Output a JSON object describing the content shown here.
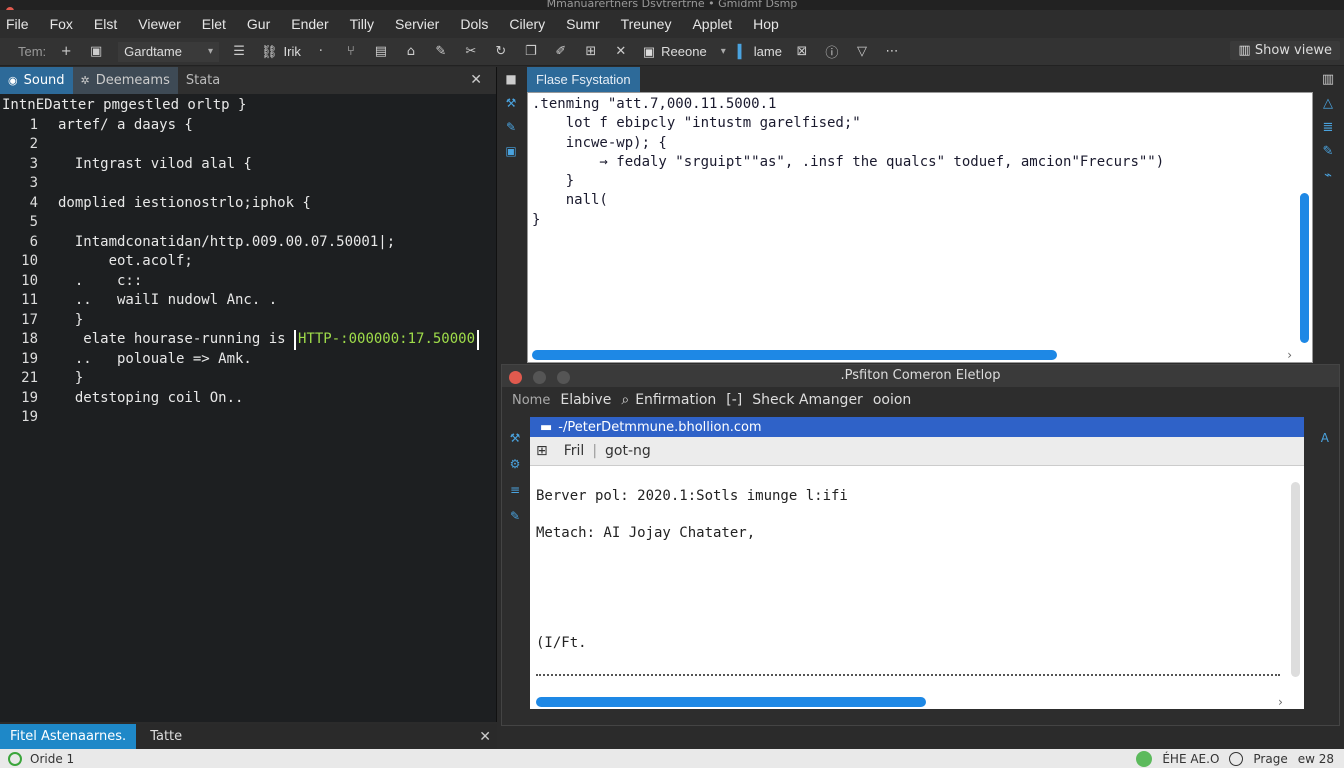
{
  "window": {
    "title": "Mmanuarertners Dsvtrertrne • Gmidmf Dsmp"
  },
  "menubar": [
    "File",
    "Fox",
    "Elst",
    "Viewer",
    "Elet",
    "Gur",
    "Ender",
    "Tilly",
    "Servier",
    "Dols",
    "Cilery",
    "Sumr",
    "Treuney",
    "Applet",
    "Hop"
  ],
  "toolbar": {
    "term_label": "Tem:",
    "select_value": "Gardtame",
    "link_label": "Irik",
    "rename_label": "Reeone",
    "lame_label": "lame",
    "show_view": "Show viewe"
  },
  "left_panel": {
    "tabs": [
      "Sound",
      "Deemeams",
      "Stata"
    ],
    "header": "IntnEDatter pmgestled orltp }",
    "lines": [
      {
        "num": "1",
        "text": "artef/ a daays {"
      },
      {
        "num": "2",
        "text": ""
      },
      {
        "num": "3",
        "text": "  Intgrast vilod alal {"
      },
      {
        "num": "3",
        "text": ""
      },
      {
        "num": "4",
        "text": "domplied iestionostrlo;iphok {"
      },
      {
        "num": "5",
        "text": ""
      },
      {
        "num": "6",
        "text": "  Intamdconatidan/http.009.00.07.50001|;"
      },
      {
        "num": "10",
        "text": "      eot.acolf;"
      },
      {
        "num": "10",
        "text": "  .    c::"
      },
      {
        "num": "11",
        "text": "  ..   wailI nudowl Anc. ."
      },
      {
        "num": "17",
        "text": "  }"
      },
      {
        "num": "18",
        "text": "   elate hourase-running is ",
        "highlight": "HTTP-:000000:17.50000"
      },
      {
        "num": "19",
        "text": "  ..   polouale => Amk."
      },
      {
        "num": "21",
        "text": "  }"
      },
      {
        "num": "19",
        "text": "  detstoping coil On.."
      },
      {
        "num": "19",
        "text": ""
      }
    ],
    "bottom_tabs": [
      "Fitel Astenaarnes.",
      "Tatte"
    ]
  },
  "right_top": {
    "tab": "Flase Fsystation",
    "lines": [
      ".tenming \"att.7,000.11.5000.1",
      "    lot f ebipcly \"intustm garelfised;\"",
      "    incwe-wp); {",
      "        → fedaly \"srguipt\"\"as\", .insf the qualcs\" toduef, amcion\"Frecurs\"\")",
      "    }",
      "    nall(",
      "}"
    ]
  },
  "bottom_window": {
    "title": ".Psfiton Comeron Eletlop",
    "menu": [
      "Nome",
      "Elabive",
      "Enfirmation",
      "[-]",
      "Sheck Amanger",
      "ooion"
    ],
    "url": "-/PeterDetmmune.bhollion.com",
    "sub_items": [
      "Fril",
      "got-ng"
    ],
    "body_lines": [
      "Berver pol: 2020.1:Sotls imunge l:ifi",
      "Metach: AI Jojay Chatater,",
      "(I/Ft."
    ]
  },
  "statusbar": {
    "left": "Oride 1",
    "right_items": [
      "ÉHE AE.O",
      "Prage",
      "ew 28"
    ]
  },
  "colors": {
    "accent": "#1e88e5",
    "tab_active": "#2d6a99",
    "highlight_text": "#9fdc4a"
  }
}
